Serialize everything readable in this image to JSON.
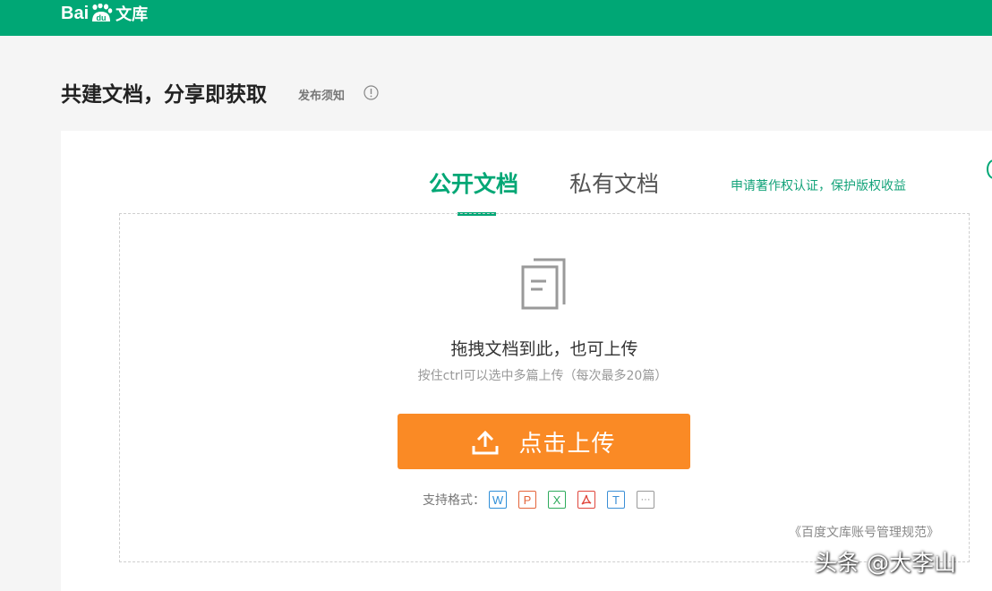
{
  "header": {
    "logo_text_left": "Bai",
    "logo_text_paw": "du",
    "logo_text_right": "文库",
    "bg_color": "#00a775"
  },
  "page": {
    "title": "共建文档，分享即获取",
    "notice_link": "发布须知",
    "info_icon": "info-circle-icon"
  },
  "tabs": [
    {
      "label": "公开文档",
      "active": true
    },
    {
      "label": "私有文档",
      "active": false
    }
  ],
  "copyright_link": "申请著作权认证，保护版权收益",
  "upload": {
    "drop_text": "拖拽文档到此，也可上传",
    "hint": "按住ctrl可以选中多篇上传（每次最多20篇）",
    "button_label": "点击上传",
    "button_icon": "upload-arrow-icon",
    "button_color": "#fa8a25"
  },
  "formats": {
    "label": "支持格式：",
    "items": [
      {
        "name": "word-format-icon",
        "glyph": "W"
      },
      {
        "name": "ppt-format-icon",
        "glyph": "P"
      },
      {
        "name": "excel-format-icon",
        "glyph": "X"
      },
      {
        "name": "pdf-format-icon",
        "glyph": "pdf"
      },
      {
        "name": "txt-format-icon",
        "glyph": "T"
      },
      {
        "name": "more-formats-icon",
        "glyph": "···"
      }
    ]
  },
  "rules_link": "《百度文库账号管理规范》",
  "watermark": "头条 @大李山"
}
